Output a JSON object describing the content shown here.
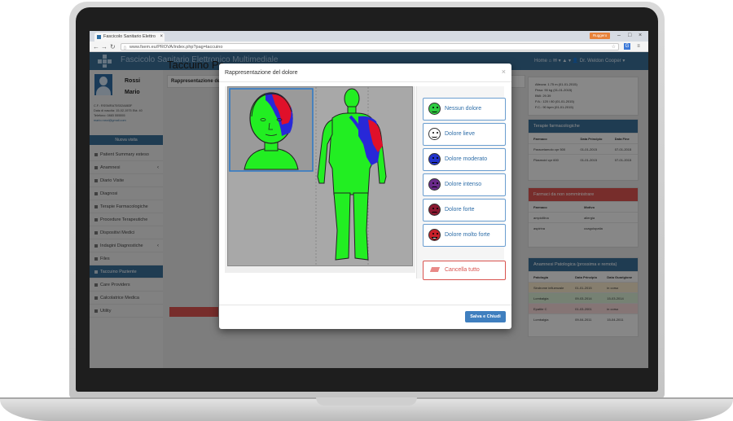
{
  "browser": {
    "tab_title": "Fascicolo Sanitario Elettro",
    "tab_close": "×",
    "user_badge": "Ruggero",
    "url": "www.fsem.eu/PROVA/index.php?pag=taccuino",
    "win_min": "–",
    "win_max": "□",
    "win_close": "×"
  },
  "app": {
    "title": "Fascicolo Sanitario Elettronico Multimediale",
    "header_nav": "Home ⌂  ✉ ▾  ▲ ▾  👤 Dr. Weldon Cooper ▾"
  },
  "patient": {
    "surname": "Rossi",
    "name": "Mario",
    "cf": "C.F.: RSSMRA75S02A883F",
    "birth": "Data di nascita: 15-02-1975 Età: 40",
    "phone": "Telefono: 0883 555555",
    "email": "mario.rossi@gmail.com"
  },
  "sidebar": {
    "new_visit": "Nuova visita",
    "items": [
      {
        "label": "Patient Summary esteso"
      },
      {
        "label": "Anamnesi",
        "chevron": "‹"
      },
      {
        "label": "Diario Visite"
      },
      {
        "label": "Diagnosi"
      },
      {
        "label": "Terapie Farmacologiche"
      },
      {
        "label": "Procedure Terapeutiche"
      },
      {
        "label": "Dispositivi Medici"
      },
      {
        "label": "Indagini Diagnostiche",
        "chevron": "‹"
      },
      {
        "label": "Files"
      },
      {
        "label": "Taccuino Paziente"
      },
      {
        "label": "Care Providers"
      },
      {
        "label": "Calcolatrice Medica"
      },
      {
        "label": "Utility"
      }
    ]
  },
  "main": {
    "page_title": "Taccuino Pa",
    "panel_title": "Rappresentazione de"
  },
  "vitals": {
    "lines": [
      "Altezza: 1.75 m (01-01-2015)",
      "Peso: 90 kg (01-01-2015)",
      "BMI: 29.39",
      "P.A.: 120 / 80 (01-01-2015)",
      "F.C.: 90 bpm (01-01-2015)"
    ]
  },
  "terapie": {
    "title": "Terapie farmacologiche",
    "header": [
      "Farmaco",
      "Data Principio",
      "Data Fine"
    ],
    "rows": [
      [
        "Paracetamolo cpr 500",
        "01-01-2015",
        "07-01-2015"
      ],
      [
        "Plasmoid cpr 600",
        "01-01-2015",
        "07-01-2015"
      ]
    ]
  },
  "farmaci": {
    "title": "Farmaci da non somministrare",
    "header": [
      "Farmaco",
      "Motivo"
    ],
    "rows": [
      [
        "ampicillina",
        "allergia"
      ],
      [
        "aspirina",
        "coagulopatia"
      ]
    ]
  },
  "anamnesi": {
    "title": "Anamnesi Patologica (prossima e remota)",
    "header": [
      "Patologia",
      "Data Principio",
      "Data Guarigione"
    ],
    "rows": [
      {
        "cells": [
          "Sindrome influenzale",
          "01-01-2015",
          "in corso"
        ],
        "color": "#f5e6c8"
      },
      {
        "cells": [
          "Lombalgia",
          "09-03-2014",
          "15-03-2014"
        ],
        "color": "#d7ecd2"
      },
      {
        "cells": [
          "Epatite C",
          "01-03-2001",
          "in corso"
        ],
        "color": "#f2d6d6"
      },
      {
        "cells": [
          "Lombalgia",
          "09-04-2011",
          "15-04-2011"
        ],
        "color": "#f6f6f6"
      }
    ]
  },
  "modal": {
    "title": "Rappresentazione del dolore",
    "close": "×",
    "save_label": "Salva e Chiudi",
    "cancel_label": "Cancella tutto",
    "pain_levels": [
      {
        "label": "Nessun dolore",
        "color": "#2ecc40"
      },
      {
        "label": "Dolore lieve",
        "color": "#ffffff"
      },
      {
        "label": "Dolore moderato",
        "color": "#2233cc"
      },
      {
        "label": "Dolore intenso",
        "color": "#6a2a8a"
      },
      {
        "label": "Dolore forte",
        "color": "#8b1830"
      },
      {
        "label": "Dolore molto forte",
        "color": "#c8202a"
      }
    ]
  },
  "colors": {
    "accent": "#3a6d96",
    "body_green": "#22ee22",
    "pain_red": "#e0102a",
    "pain_blue": "#2828d8"
  }
}
